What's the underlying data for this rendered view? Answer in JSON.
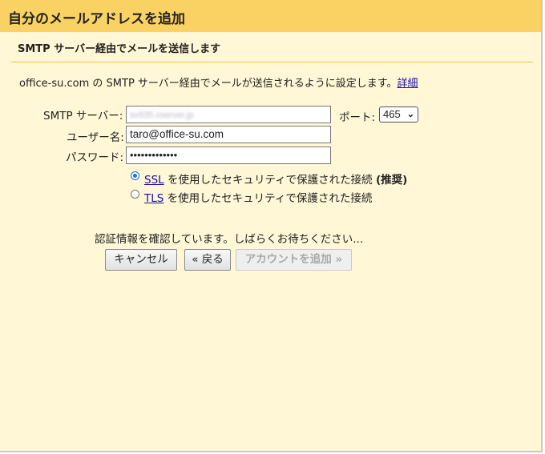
{
  "dialog": {
    "title": "自分のメールアドレスを追加",
    "subtitle": "SMTP サーバー経由でメールを送信します",
    "description": "office-su.com の SMTP サーバー経由でメールが送信されるように設定します。",
    "details_link": "詳細"
  },
  "form": {
    "smtp_label": "SMTP サーバー:",
    "smtp_value": "sv935.xserver.jp",
    "port_label": "ポート:",
    "port_value": "465",
    "username_label": "ユーザー名:",
    "username_value": "taro@office-su.com",
    "password_label": "パスワード:",
    "password_value": "•••••••••••••"
  },
  "security": {
    "ssl_link": "SSL",
    "ssl_text": "を使用したセキュリティで保護された接続",
    "ssl_recommended": "(推奨)",
    "tls_link": "TLS",
    "tls_text": "を使用したセキュリティで保護された接続",
    "selected": "SSL"
  },
  "status": {
    "text": "認証情報を確認しています。しばらくお待ちください..."
  },
  "buttons": {
    "cancel": "キャンセル",
    "back": "« 戻る",
    "add_account": "アカウントを追加 »"
  },
  "colors": {
    "titlebar": "#fad163",
    "panel": "#fff7d6",
    "link": "#1a0dab",
    "radio_accent": "#1a73e8"
  }
}
